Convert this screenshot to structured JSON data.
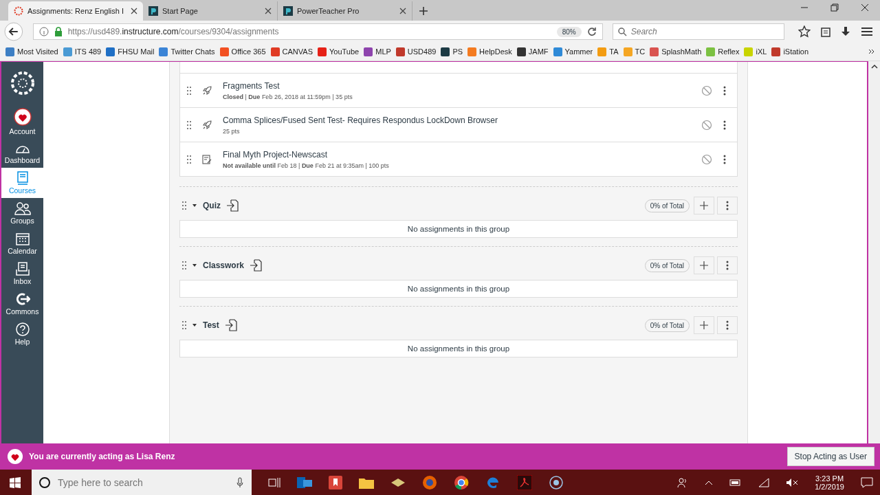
{
  "browser": {
    "tabs": [
      {
        "title": "Assignments: Renz English I",
        "selected": true
      },
      {
        "title": "Start Page",
        "selected": false
      },
      {
        "title": "PowerTeacher Pro",
        "selected": false
      }
    ],
    "url_host": "https://usd489.",
    "url_domain": "instructure.com",
    "url_path": "/courses/9304/assignments",
    "zoom": "80%",
    "search_placeholder": "Search",
    "bookmarks": [
      {
        "label": "Most Visited",
        "color": "#3d7fc4"
      },
      {
        "label": "ITS 489",
        "color": "#4a9ad4"
      },
      {
        "label": "FHSU Mail",
        "color": "#1f6fc5"
      },
      {
        "label": "Twitter Chats",
        "color": "#3b84d6"
      },
      {
        "label": "Office 365",
        "color": "#f25022"
      },
      {
        "label": "CANVAS",
        "color": "#e03b24"
      },
      {
        "label": "YouTube",
        "color": "#e62117"
      },
      {
        "label": "MLP",
        "color": "#8e44ad"
      },
      {
        "label": "USD489",
        "color": "#c0392b"
      },
      {
        "label": "PS",
        "color": "#1c3a44"
      },
      {
        "label": "HelpDesk",
        "color": "#f47b20"
      },
      {
        "label": "JAMF",
        "color": "#333333"
      },
      {
        "label": "Yammer",
        "color": "#2f8ad7"
      },
      {
        "label": "TA",
        "color": "#f39c12"
      },
      {
        "label": "TC",
        "color": "#f5a623"
      },
      {
        "label": "SplashMath",
        "color": "#d9534f"
      },
      {
        "label": "Reflex",
        "color": "#7cc142"
      },
      {
        "label": "iXL",
        "color": "#c8d400"
      },
      {
        "label": "iStation",
        "color": "#c0392b"
      }
    ]
  },
  "nav": [
    {
      "label": "Account",
      "selected": false
    },
    {
      "label": "Dashboard",
      "selected": false
    },
    {
      "label": "Courses",
      "selected": true
    },
    {
      "label": "Groups",
      "selected": false
    },
    {
      "label": "Calendar",
      "selected": false
    },
    {
      "label": "Inbox",
      "selected": false
    },
    {
      "label": "Commons",
      "selected": false
    },
    {
      "label": "Help",
      "selected": false
    }
  ],
  "assignments": [
    {
      "title": "Fragments Test",
      "kind": "quiz",
      "meta": "**Closed**  |  **Due** Feb 26, 2018 at 11:59pm  |  35 pts",
      "published": false
    },
    {
      "title": "Comma Splices/Fused Sent Test- Requires Respondus LockDown Browser",
      "kind": "quiz",
      "meta": "25 pts",
      "published": false
    },
    {
      "title": "Final Myth Project-Newscast",
      "kind": "assignment",
      "meta": "**Not available until** Feb 18  |  **Due** Feb 21 at 9:35am  |  100 pts",
      "published": false
    }
  ],
  "groups": [
    {
      "name": "Quiz",
      "expanded": true,
      "total": "0% of Total",
      "empty": "No assignments in this group"
    },
    {
      "name": "Classwork",
      "expanded": true,
      "total": "0% of Total",
      "empty": "No assignments in this group"
    },
    {
      "name": "Test",
      "expanded": true,
      "total": "0% of Total",
      "empty": "No assignments in this group"
    }
  ],
  "masquerade": {
    "text": "You are currently acting as Lisa Renz",
    "button": "Stop Acting as User"
  },
  "taskbar": {
    "search_placeholder": "Type here to search",
    "time": "3:23 PM",
    "date": "1/2/2019"
  }
}
